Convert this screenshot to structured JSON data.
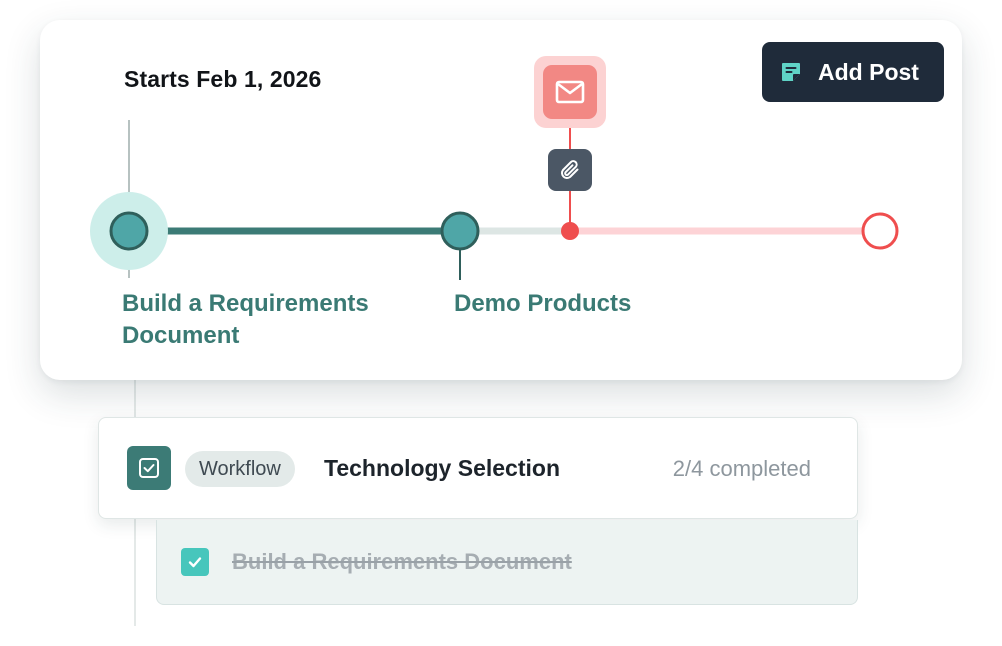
{
  "timeline": {
    "start_label": "Starts Feb 1, 2026",
    "add_post_label": "Add Post",
    "milestones": [
      {
        "label": "Build a Requirements Document",
        "status": "completed"
      },
      {
        "label": "Demo Products",
        "status": "completed"
      }
    ],
    "markers": [
      {
        "type": "email",
        "icon": "mail-icon"
      },
      {
        "type": "attachment",
        "icon": "paperclip-icon"
      }
    ],
    "end_marker": {
      "icon": "open-circle-icon"
    }
  },
  "workflow": {
    "badge": "Workflow",
    "title": "Technology Selection",
    "progress": "2/4 completed",
    "tasks": [
      {
        "title": "Build a Requirements Document",
        "done": true
      }
    ]
  },
  "colors": {
    "teal": "#3c7b76",
    "teal_light": "#4fa6a7",
    "red": "#ef4e4e",
    "dark": "#1f2b3a"
  }
}
